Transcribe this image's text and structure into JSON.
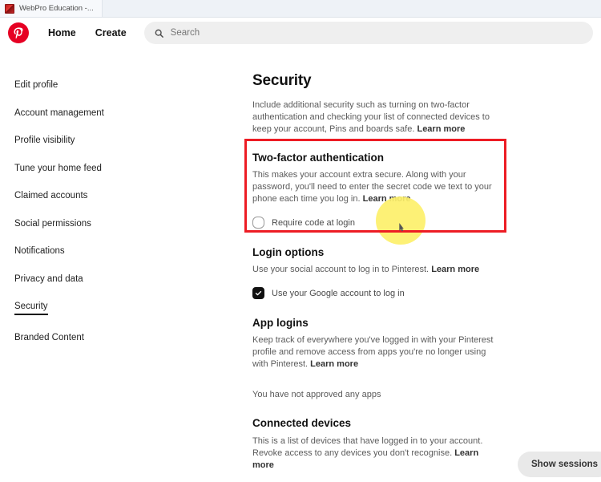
{
  "browser": {
    "tab_title": "WebPro Education -...",
    "favicon": "webpro-favicon"
  },
  "header": {
    "logo": "pinterest-logo-icon",
    "nav": [
      {
        "label": "Home",
        "name": "nav-home"
      },
      {
        "label": "Create",
        "name": "nav-create"
      }
    ],
    "search": {
      "icon": "search-icon",
      "placeholder": "Search",
      "value": ""
    }
  },
  "sidebar": {
    "items": [
      {
        "label": "Edit profile",
        "active": false
      },
      {
        "label": "Account management",
        "active": false
      },
      {
        "label": "Profile visibility",
        "active": false
      },
      {
        "label": "Tune your home feed",
        "active": false
      },
      {
        "label": "Claimed accounts",
        "active": false
      },
      {
        "label": "Social permissions",
        "active": false
      },
      {
        "label": "Notifications",
        "active": false
      },
      {
        "label": "Privacy and data",
        "active": false
      },
      {
        "label": "Security",
        "active": true
      },
      {
        "label": "Branded Content",
        "active": false
      }
    ]
  },
  "main": {
    "page_title": "Security",
    "page_description": "Include additional security such as turning on two-factor authentication and checking your list of connected devices to keep your account, Pins and boards safe.",
    "page_description_link": "Learn more",
    "two_factor": {
      "title": "Two-factor authentication",
      "description": "This makes your account extra secure. Along with your password, you'll need to enter the secret code we text to your phone each time you log in.",
      "description_link": "Learn more",
      "checkbox_label": "Require code at login",
      "checkbox_checked": false
    },
    "login_options": {
      "title": "Login options",
      "description": "Use your social account to log in to Pinterest.",
      "description_link": "Learn more",
      "checkbox_label": "Use your Google account to log in",
      "checkbox_checked": true
    },
    "app_logins": {
      "title": "App logins",
      "description": "Keep track of everywhere you've logged in with your Pinterest profile and remove access from apps you're no longer using with Pinterest.",
      "description_link": "Learn more",
      "status": "You have not approved any apps"
    },
    "connected_devices": {
      "title": "Connected devices",
      "description": "This is a list of devices that have logged in to your account. Revoke access to any devices you don't recognise.",
      "description_link": "Learn more",
      "button_label": "Show sessions"
    }
  },
  "annotations": {
    "highlight_box_color": "#ed1c24",
    "click_blob_color": "#fdf06a"
  },
  "colors": {
    "brand_red": "#e60023",
    "text_primary": "#111111",
    "text_secondary": "#5b5b5b",
    "chrome_bg": "#eef2f7",
    "search_bg": "#efefef",
    "button_bg": "#e9e9e9"
  }
}
